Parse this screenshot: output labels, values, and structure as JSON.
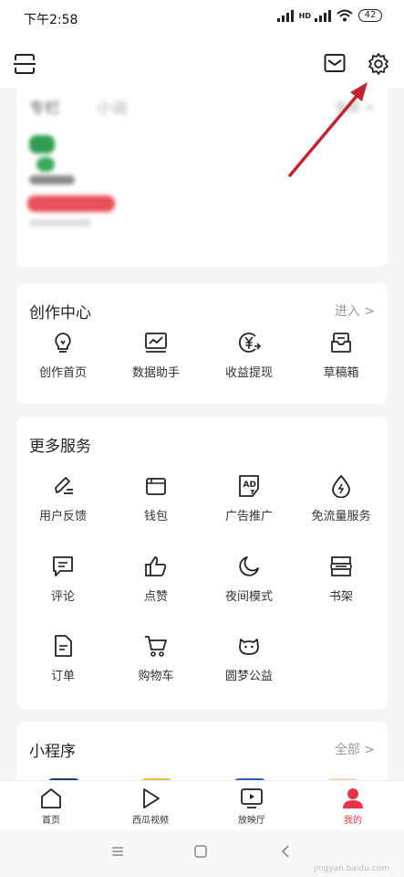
{
  "status": {
    "time": "下午2:58",
    "network": "HD",
    "battery": "42"
  },
  "topbar": {
    "icons": [
      "scan-icon",
      "mail-icon",
      "gear-icon"
    ]
  },
  "blurred_section": {
    "tabs": [
      "专栏",
      "小说"
    ],
    "more": "全部 >"
  },
  "creation": {
    "title": "创作中心",
    "more": "进入 >",
    "items": [
      {
        "label": "创作首页",
        "icon": "bulb-icon"
      },
      {
        "label": "数据助手",
        "icon": "chart-icon"
      },
      {
        "label": "收益提现",
        "icon": "yen-icon"
      },
      {
        "label": "草稿箱",
        "icon": "draft-icon"
      }
    ]
  },
  "services": {
    "title": "更多服务",
    "items": [
      {
        "label": "用户反馈",
        "icon": "pen-icon"
      },
      {
        "label": "钱包",
        "icon": "wallet-icon"
      },
      {
        "label": "广告推广",
        "icon": "ad-icon"
      },
      {
        "label": "免流量服务",
        "icon": "drop-icon"
      },
      {
        "label": "评论",
        "icon": "comment-icon"
      },
      {
        "label": "点赞",
        "icon": "thumb-icon"
      },
      {
        "label": "夜间模式",
        "icon": "moon-icon"
      },
      {
        "label": "书架",
        "icon": "bookshelf-icon"
      },
      {
        "label": "订单",
        "icon": "order-icon"
      },
      {
        "label": "购物车",
        "icon": "cart-icon"
      },
      {
        "label": "圆梦公益",
        "icon": "cat-icon"
      }
    ]
  },
  "miniprograms": {
    "title": "小程序",
    "more": "全部 >"
  },
  "bottom_nav": [
    {
      "label": "首页",
      "icon": "home-icon"
    },
    {
      "label": "西瓜视频",
      "icon": "play-icon"
    },
    {
      "label": "放映厅",
      "icon": "tv-icon"
    },
    {
      "label": "我的",
      "icon": "user-icon"
    }
  ],
  "system_nav": [
    "menu-icon",
    "home-square-icon",
    "back-icon"
  ],
  "watermark": "jingyan.baidu.com",
  "colors": {
    "accent": "#e8344a",
    "arrow": "#c0262d",
    "text": "#222222",
    "muted": "#999999"
  }
}
